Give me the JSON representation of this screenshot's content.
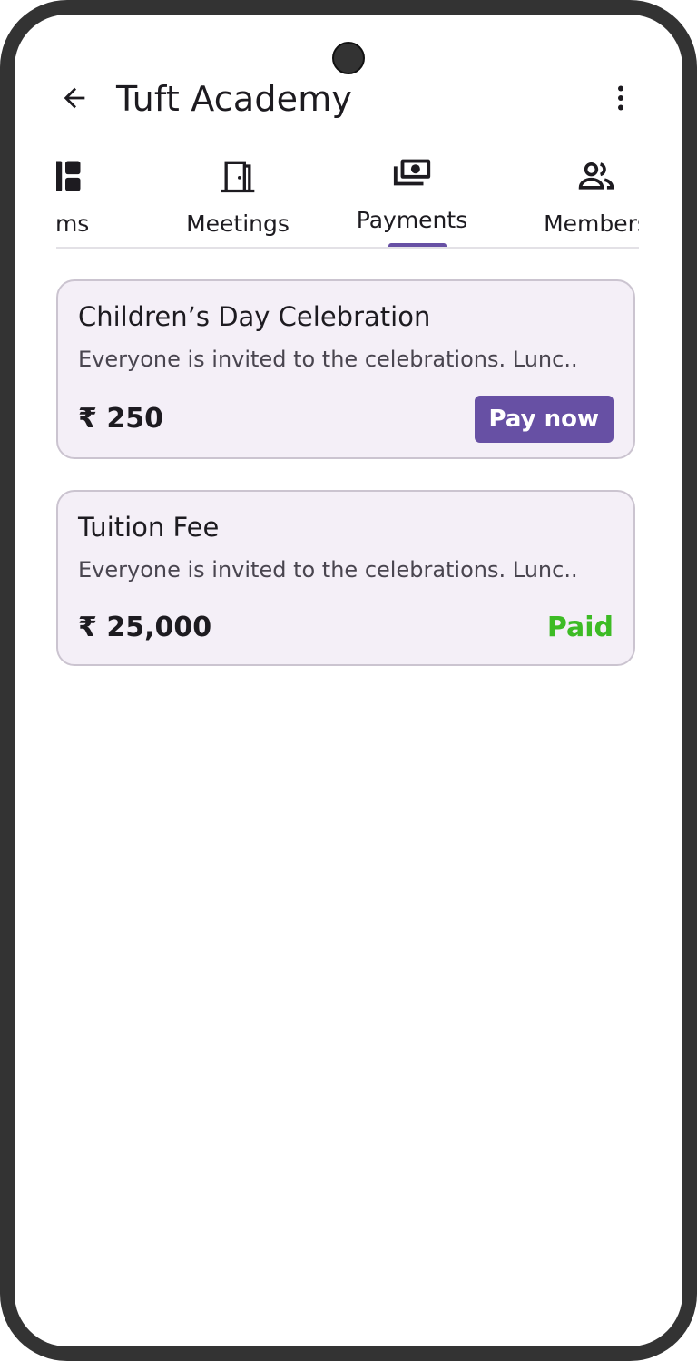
{
  "app_bar": {
    "title": "Tuft Academy",
    "back_icon": "arrow-back-icon",
    "menu_icon": "more-vert-icon"
  },
  "tabs": [
    {
      "label": "oms",
      "icon": "rooms-dashboard-icon"
    },
    {
      "label": "Meetings",
      "icon": "door-icon"
    },
    {
      "label": "Payments",
      "icon": "payments-cash-icon",
      "active": true
    },
    {
      "label": "Members",
      "icon": "group-icon"
    }
  ],
  "payments": [
    {
      "title": "Children’s Day Celebration",
      "description": "Everyone is invited to the celebrations. Lunc..",
      "amount": "₹ 250",
      "action_label": "Pay now"
    },
    {
      "title": "Tuition Fee",
      "description": "Everyone is invited to the celebrations. Lunc..",
      "amount": "₹ 25,000",
      "status": "Paid"
    }
  ],
  "colors": {
    "accent": "#6750a4",
    "paid": "#3dbb25",
    "card_bg": "#f4eff7",
    "card_border": "#cbc4d0",
    "frame": "#333333"
  }
}
